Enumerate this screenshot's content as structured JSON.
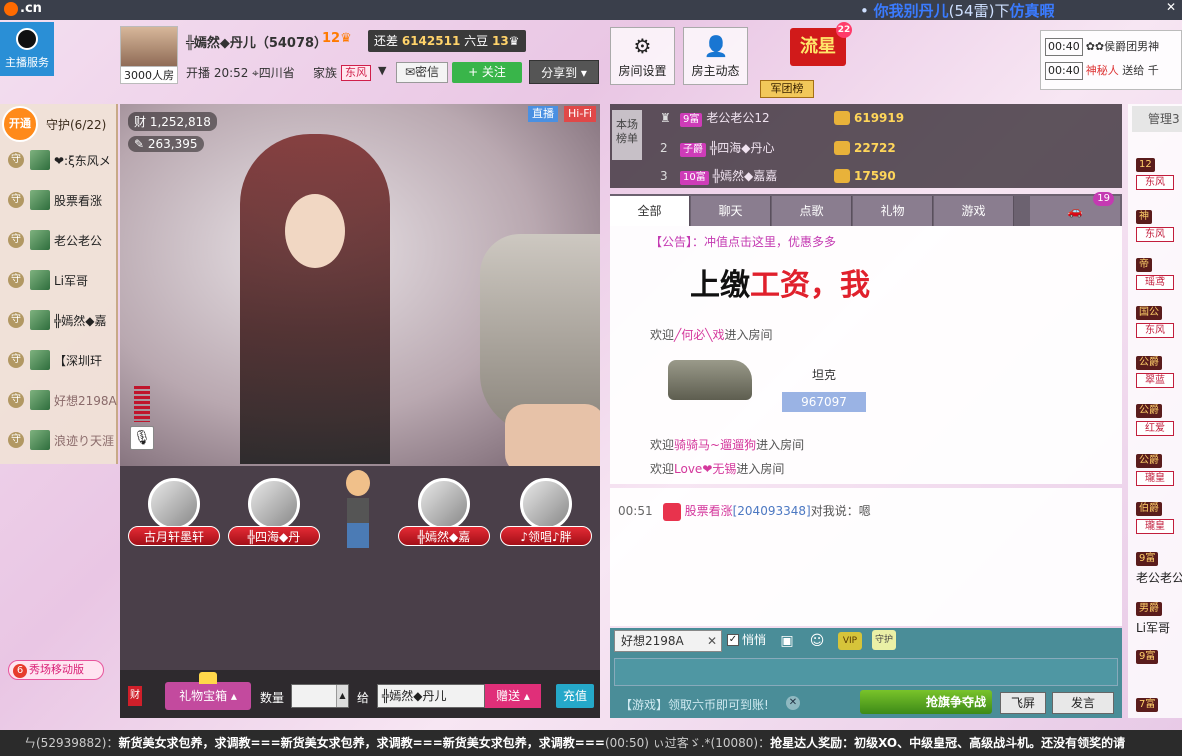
{
  "top": {
    "logo": ".cn",
    "marquee_prefix": "• ",
    "marquee_text": "你我别丹儿",
    "marquee_mid": "(54",
    "marquee_tail": "雷)下",
    "marquee_end": "仿真暇"
  },
  "anchor_service": "主播服务",
  "anchor": {
    "name": "╬嫣然◆丹儿（54078）",
    "level": "12",
    "gap_label": "还差",
    "gap_value": "6142511",
    "gap_unit": "六豆",
    "next_level": "13",
    "room_count": "3000人房",
    "live_time": "开播 20:52",
    "location": "四川省",
    "family_label": "家族",
    "family_name": "东风",
    "msg_label": "密信",
    "follow_label": "+ 关注",
    "share_label": "分享到"
  },
  "tools": {
    "room_settings": "房间设置",
    "owner_feed": "房主动态"
  },
  "liuxing": {
    "label": "流星",
    "count": "22"
  },
  "army_rank": "军团榜",
  "gift_notice": [
    {
      "time": "00:40",
      "text": "✿✿侯爵团男神"
    },
    {
      "time": "00:40",
      "text": "神秘人",
      "action": " 送给 千"
    }
  ],
  "guard": {
    "open": "开通",
    "title": "守护(6/22)",
    "items": [
      {
        "name": "❤:ξ东风メ",
        "dim": false
      },
      {
        "name": "股票看涨",
        "dim": false
      },
      {
        "name": "老公老公",
        "dim": false
      },
      {
        "name": "Li军哥",
        "dim": false
      },
      {
        "name": "╬嫣然◆嘉",
        "dim": false
      },
      {
        "name": "【深圳玕",
        "dim": false
      },
      {
        "name": "好想2198A",
        "dim": true
      },
      {
        "name": "浪迹り天涯",
        "dim": true
      }
    ]
  },
  "video": {
    "stat_1": "1,252,818",
    "stat_2": "263,395",
    "live": "直播",
    "hifi": "Hi-Fi"
  },
  "seats": [
    {
      "name": "古月轩墨轩"
    },
    {
      "name": "╬四海◆丹"
    },
    {
      "name": "╬嫣然◆嘉"
    },
    {
      "name": "♪领唱♪胖"
    }
  ],
  "gift_bar": {
    "coin": "财",
    "gift_box": "礼物宝箱",
    "qty_label": "数量",
    "give_label": "给",
    "recipient": "╬嫣然◆丹儿",
    "send": "赠送",
    "recharge": "充值"
  },
  "mobile_show": "秀场移动版",
  "rank": {
    "tag": "本场榜单",
    "rows": [
      {
        "no": "1",
        "level": "9富",
        "name": "老公老公12",
        "score": "619919"
      },
      {
        "no": "2",
        "level": "子爵",
        "name": "╬四海◆丹心",
        "score": "22722"
      },
      {
        "no": "3",
        "level": "10富",
        "name": "╬嫣然◆嘉嘉",
        "score": "17590"
      }
    ]
  },
  "chat_tabs": [
    "全部",
    "聊天",
    "点歌",
    "礼物",
    "游戏"
  ],
  "car_count": "19",
  "chat": {
    "promo": "【公告】：冲值点击这里，优惠多多",
    "overlay_a": "上缴",
    "overlay_b": "工资",
    "overlay_c": "，我",
    "welcome_1_pre": "欢迎",
    "welcome_1_user": "╱何必╲戏",
    "welcome_1_post": "进入房间",
    "tank_label": "坦克",
    "tank_num": "967097",
    "welcome_2_pre": "欢迎",
    "welcome_2_user": "骑骑马~遛遛狗",
    "welcome_2_post": "进入房间",
    "welcome_3_pre": "欢迎",
    "welcome_3_user": "Love❤无锡",
    "welcome_3_post": "进入房间",
    "pm_time": "00:51",
    "pm_user": "股票看涨",
    "pm_id": "[204093348]",
    "pm_text": "对我说：嗯"
  },
  "chat_input": {
    "target": "好想2198A",
    "whisper": "悄悄",
    "vip": "VIP",
    "guard": "守护",
    "placeholder": "",
    "game_notice": "【游戏】领取六币即可到账!",
    "flag_event": "抢旗争夺战",
    "fly": "飞屏",
    "send": "发言"
  },
  "admin": {
    "title": "管理3",
    "items": [
      {
        "level": "12",
        "family": "东风",
        "name": ""
      },
      {
        "level": "神",
        "family": "东风",
        "name": ""
      },
      {
        "level": "帝",
        "family": "瑶鸢",
        "name": ""
      },
      {
        "level": "国公",
        "family": "东风",
        "name": ""
      },
      {
        "level": "公爵",
        "family": "翠蓝",
        "name": ""
      },
      {
        "level": "公爵",
        "family": "红爱",
        "name": ""
      },
      {
        "level": "公爵",
        "family": "瓏皇",
        "name": ""
      },
      {
        "level": "伯爵",
        "family": "瓏皇",
        "name": ""
      },
      {
        "level": "9富",
        "family": "",
        "name": "老公老公"
      },
      {
        "level": "男爵",
        "family": "",
        "name": "Li军哥"
      },
      {
        "level": "9富",
        "family": "",
        "name": ""
      },
      {
        "level": "7富",
        "family": "",
        "name": ""
      }
    ]
  },
  "ticker": {
    "a": "ㄣ(52939882)：",
    "b": "新货美女求包养，求调教===新货美女求包养，求调教===新货美女求包养，求调教===",
    "c": "(00:50)",
    "d": "ぃ过客ゞ.*(10080)：",
    "e": "抢星达人奖励：初级XO、中级皇冠、高级战斗机。还没有领奖的请"
  }
}
